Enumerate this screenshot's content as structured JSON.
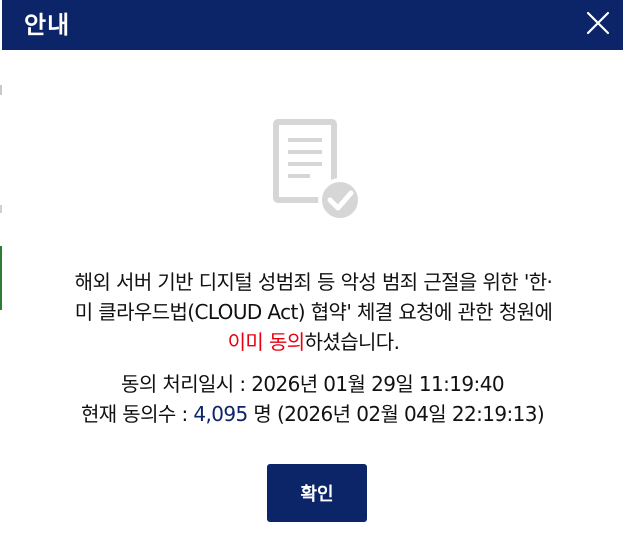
{
  "modal": {
    "title": "안내",
    "close_icon": "close-icon",
    "document_icon": "document-check-icon",
    "message": {
      "line1": "해외 서버 기반 디지털 성범죄 등 악성 범죄 근절을 위한 '한·",
      "line2": "미 클라우드법(CLOUD Act) 협약' 체결 요청에 관한 청원에",
      "highlight": "이미 동의",
      "suffix": "하셨습니다."
    },
    "info": {
      "processed_label": "동의 처리일시 : ",
      "processed_datetime": "2026년 01월 29일 11:19:40",
      "count_label": "현재 동의수 : ",
      "count_value": "4,095",
      "count_unit": " 명 ",
      "count_datetime": "(2026년 02월 04일 22:19:13)"
    },
    "confirm_label": "확인"
  },
  "colors": {
    "header_bg": "#0c2468",
    "button_bg": "#0c2468",
    "highlight": "#e60012",
    "count_value": "#0c2468",
    "icon_gray": "#d6d6d6"
  }
}
